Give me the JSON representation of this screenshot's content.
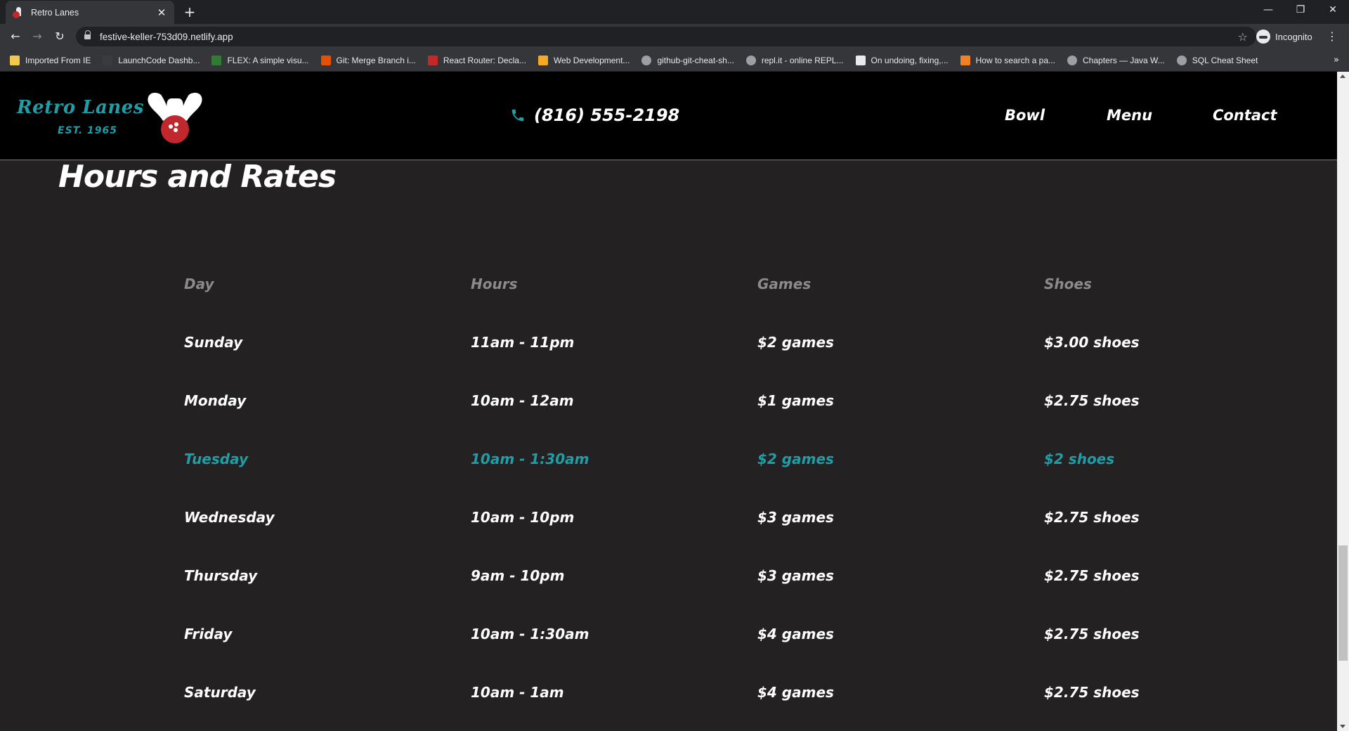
{
  "browser": {
    "tab_title": "Retro Lanes",
    "tab_close": "✕",
    "new_tab": "+",
    "url": "festive-keller-753d09.netlify.app",
    "profile_label": "Incognito",
    "window_controls": {
      "minimize": "—",
      "restore": "❐",
      "close": "✕"
    },
    "nav": {
      "back": "←",
      "forward": "→",
      "reload": "↻",
      "star": "☆",
      "menu": "⋮"
    },
    "bookmarks": [
      {
        "label": "Imported From IE",
        "icon": "folder-icon",
        "color": "#f2c94c"
      },
      {
        "label": "LaunchCode Dashb...",
        "icon": "launchcode-icon",
        "color": "#3a3b3e"
      },
      {
        "label": "FLEX: A simple visu...",
        "icon": "flex-icon",
        "color": "#2e7d32"
      },
      {
        "label": "Git: Merge Branch i...",
        "icon": "git-icon",
        "color": "#e65100"
      },
      {
        "label": "React Router: Decla...",
        "icon": "react-router-icon",
        "color": "#c62828"
      },
      {
        "label": "Web Development...",
        "icon": "web-dev-icon",
        "color": "#f9a825"
      },
      {
        "label": "github-git-cheat-sh...",
        "icon": "globe-icon",
        "color": "#9aa0a6"
      },
      {
        "label": "repl.it - online REPL...",
        "icon": "replit-icon",
        "color": "#9aa0a6"
      },
      {
        "label": "On undoing, fixing,...",
        "icon": "atlassian-icon",
        "color": "#e8eaed"
      },
      {
        "label": "How to search a pa...",
        "icon": "stackoverflow-icon",
        "color": "#f48024"
      },
      {
        "label": "Chapters — Java W...",
        "icon": "globe-icon",
        "color": "#9aa0a6"
      },
      {
        "label": "SQL Cheat Sheet",
        "icon": "globe-icon",
        "color": "#9aa0a6"
      }
    ],
    "bookmarks_more": "»"
  },
  "header": {
    "logo_name": "Retro Lanes",
    "logo_est": "EST. 1965",
    "phone": "(816) 555-2198",
    "nav": [
      {
        "label": "Bowl"
      },
      {
        "label": "Menu"
      },
      {
        "label": "Contact"
      }
    ]
  },
  "section": {
    "title": "Hours and Rates"
  },
  "table": {
    "headers": [
      "Day",
      "Hours",
      "Games",
      "Shoes"
    ],
    "rows": [
      {
        "day": "Sunday",
        "hours": "11am - 11pm",
        "games": "$2 games",
        "shoes": "$3.00 shoes",
        "highlight": false
      },
      {
        "day": "Monday",
        "hours": "10am - 12am",
        "games": "$1 games",
        "shoes": "$2.75 shoes",
        "highlight": false
      },
      {
        "day": "Tuesday",
        "hours": "10am - 1:30am",
        "games": "$2 games",
        "shoes": "$2 shoes",
        "highlight": true
      },
      {
        "day": "Wednesday",
        "hours": "10am - 10pm",
        "games": "$3 games",
        "shoes": "$2.75 shoes",
        "highlight": false
      },
      {
        "day": "Thursday",
        "hours": "9am - 10pm",
        "games": "$3 games",
        "shoes": "$2.75 shoes",
        "highlight": false
      },
      {
        "day": "Friday",
        "hours": "10am - 1:30am",
        "games": "$4 games",
        "shoes": "$2.75 shoes",
        "highlight": false
      },
      {
        "day": "Saturday",
        "hours": "10am - 1am",
        "games": "$4 games",
        "shoes": "$2.75 shoes",
        "highlight": false
      }
    ]
  },
  "colors": {
    "accent": "#1f9ea8",
    "background": "#232122",
    "header_bg": "#000000",
    "header_text": "#8b8b8b"
  }
}
